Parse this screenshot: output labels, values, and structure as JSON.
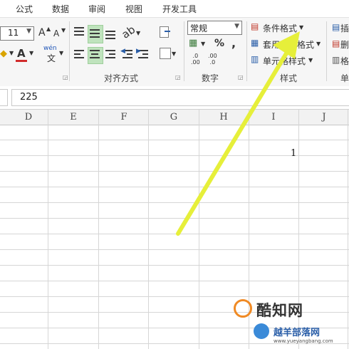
{
  "menu": {
    "tabs": [
      "公式",
      "数据",
      "审阅",
      "视图",
      "开发工具"
    ]
  },
  "font_group": {
    "font_size": "11",
    "grow_label": "A",
    "shrink_label": "A",
    "font_color_label": "A",
    "phonetic_label": "wén",
    "phonetic_sub": "文"
  },
  "alignment_group": {
    "label": "对齐方式"
  },
  "number_group": {
    "format_value": "常规",
    "percent": "%",
    "comma": ",",
    "inc_decimal": ".0\n.00",
    "dec_decimal": ".00\n.0",
    "label": "数字"
  },
  "styles_group": {
    "conditional_format": "条件格式",
    "table_format": "套用表格格式",
    "cell_styles": "单元格样式",
    "label": "样式"
  },
  "cells_group": {
    "label": "单"
  },
  "formula_bar": {
    "value": "225"
  },
  "columns": [
    "D",
    "E",
    "F",
    "G",
    "H",
    "I",
    "J"
  ],
  "cells": {
    "I_value": "1"
  },
  "watermark": {
    "site_cn": "酷知网",
    "site_cn2": "越羊部落网",
    "site_url": "www.yueyangbang.com"
  },
  "colors": {
    "arrow": "#e6ef3a",
    "selected_align": "#bfe3bd",
    "accent_red": "#d12b2b"
  }
}
